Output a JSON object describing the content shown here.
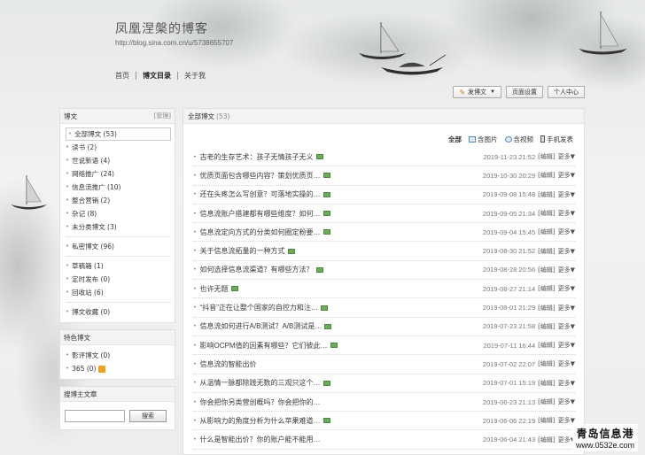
{
  "header": {
    "blog_title": "凤凰涅槃的博客",
    "blog_url": "http://blog.sina.com.cn/u/5738655707",
    "nav": [
      {
        "label": "首页"
      },
      {
        "label": "博文目录"
      },
      {
        "label": "关于我"
      }
    ],
    "buttons": {
      "post": "发博文",
      "page_settings": "页面设置",
      "personal_center": "个人中心"
    }
  },
  "sidebar": {
    "posts_panel": {
      "title": "博文",
      "manage": "[管理]",
      "categories": [
        "全部博文 (53)",
        "读书 (2)",
        "世说新语 (4)",
        "网络推广 (24)",
        "信息流推广 (10)",
        "整合营销 (2)",
        "杂记 (8)",
        "未分类博文 (3)"
      ],
      "private": "私密博文 (96)",
      "drafts": [
        "草稿箱 (1)",
        "定时发布 (0)",
        "回收站 (6)"
      ],
      "favorites": "博文收藏 (0)"
    },
    "featured_panel": {
      "title": "特色博文",
      "items": [
        "影评博文 (0)",
        "365 (0)"
      ]
    },
    "search_panel": {
      "title": "搜博主文章",
      "input_value": "",
      "button": "搜索"
    }
  },
  "main": {
    "title": "全部博文",
    "count": "(53)",
    "filters": {
      "all": "全部",
      "images": "含图片",
      "videos": "含视频",
      "mobile": "手机发表"
    },
    "edit_label": "[编辑]",
    "more_label": "更多▼",
    "articles": [
      {
        "title": "古老的生存艺术：孩子无情孩子无义",
        "date": "2019-11-23 21:52",
        "img": true
      },
      {
        "title": "优质页面包含哪些内容？策划优质页…",
        "date": "2019-10-30 20:29",
        "img": true
      },
      {
        "title": "还在头疼怎么写创意？可落地实操的…",
        "date": "2019-09-08 15:48",
        "img": true
      },
      {
        "title": "信息流账户搭建都有哪些维度？如何…",
        "date": "2019-09-05 21:34",
        "img": true
      },
      {
        "title": "信息流定向方式的分类如何圈定粉要…",
        "date": "2019-09-04 15:45",
        "img": true
      },
      {
        "title": "关于信息流拓量的一种方式",
        "date": "2019-08-30 21:52",
        "img": true
      },
      {
        "title": "如何选择信息流渠道？有哪些方法？",
        "date": "2019-08-28 20:56",
        "img": true
      },
      {
        "title": "也许无题",
        "date": "2019-08-27 21:14",
        "img": true
      },
      {
        "title": "“抖音”正在让整个国家的自控力和注…",
        "date": "2019-08-01 21:29",
        "img": true
      },
      {
        "title": "信息流如何进行A/B测试？A/B测试是…",
        "date": "2019-07-23 21:58",
        "img": true
      },
      {
        "title": "影响OCPM值的因素有哪些？它们彼此…",
        "date": "2019-07-11 16:44",
        "img": true
      },
      {
        "title": "信息流的智能出价",
        "date": "2019-07-02 22:07",
        "img": false
      },
      {
        "title": "从温情一脉都除践无数的三观只这个…",
        "date": "2019-07-01 15:19",
        "img": true
      },
      {
        "title": "你会把你另类营创概吗？你会把你的…",
        "date": "2019-06-23 21:13",
        "img": false
      },
      {
        "title": "从影响力的角度分析为什么苹果难道…",
        "date": "2019-06-06 22:19",
        "img": true
      },
      {
        "title": "什么是智能出价？你的账户能不能用…",
        "date": "2019-06-04 21:43",
        "img": false
      }
    ]
  },
  "watermark": {
    "line1": "青岛信息港",
    "line2": "www.0532e.com"
  },
  "colors": {
    "accent_link": "#3a3a3a",
    "image_badge": "#6cab5e",
    "rss": "#f0a020"
  }
}
